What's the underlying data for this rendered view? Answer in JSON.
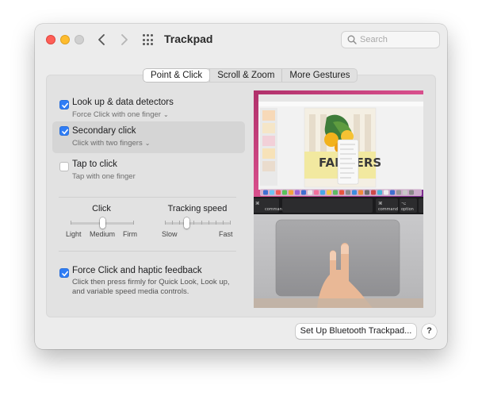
{
  "window": {
    "title": "Trackpad",
    "search_placeholder": "Search"
  },
  "tabs": [
    {
      "label": "Point & Click",
      "active": true
    },
    {
      "label": "Scroll & Zoom",
      "active": false
    },
    {
      "label": "More Gestures",
      "active": false
    }
  ],
  "options": [
    {
      "title": "Look up & data detectors",
      "subtitle": "Force Click with one finger",
      "checked": true,
      "has_menu": true
    },
    {
      "title": "Secondary click",
      "subtitle": "Click with two fingers",
      "checked": true,
      "has_menu": true,
      "selected": true
    },
    {
      "title": "Tap to click",
      "subtitle": "Tap with one finger",
      "checked": false,
      "has_menu": false
    }
  ],
  "sliders": {
    "click": {
      "label": "Click",
      "min_label": "Light",
      "mid_label": "Medium",
      "max_label": "Firm",
      "value": 0.5
    },
    "tracking": {
      "label": "Tracking speed",
      "min_label": "Slow",
      "max_label": "Fast",
      "value": 0.33
    }
  },
  "force_click": {
    "title": "Force Click and haptic feedback",
    "description": "Click then press firmly for Quick Look, Look up, and variable speed media controls.",
    "checked": true
  },
  "preview": {
    "poster_text": "FARMERS",
    "key_left_symbol": "⌘",
    "key_left_label": "command",
    "key_right1_symbol": "⌘",
    "key_right1_label": "command",
    "key_right2_symbol": "⌥",
    "key_right2_label": "option"
  },
  "buttons": {
    "setup_bluetooth": "Set Up Bluetooth Trackpad...",
    "help": "?"
  },
  "colors": {
    "accent": "#2f7df6",
    "window_bg": "#ececec",
    "panel_bg": "#e2e2e2",
    "close": "#fe5f57",
    "minimize": "#febc2e"
  },
  "icons": {
    "back": "chevron-left-icon",
    "forward": "chevron-right-icon",
    "grid": "grid-icon",
    "search": "search-icon"
  }
}
